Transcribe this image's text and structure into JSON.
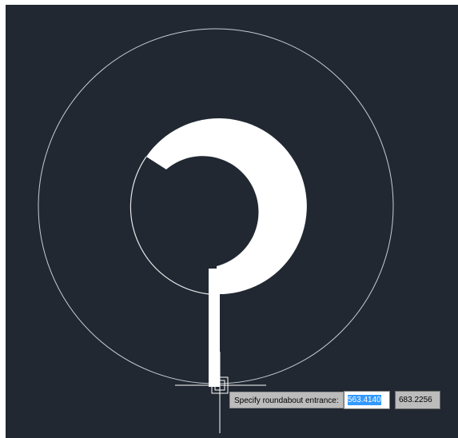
{
  "viewport": {
    "background_color": "#212832",
    "geometry_color": "#ffffff",
    "guide_color": "#c8ccd2"
  },
  "drawing": {
    "outer_circle": "roundabout-outer-circle",
    "road_ring": "roundabout-road-ring",
    "entry_road": "entrance-road",
    "cursor": "crosshair-cursor"
  },
  "prompt": {
    "label": "Specify roundabout entrance:",
    "x_value": "563.4140",
    "y_value": "683.2256"
  }
}
